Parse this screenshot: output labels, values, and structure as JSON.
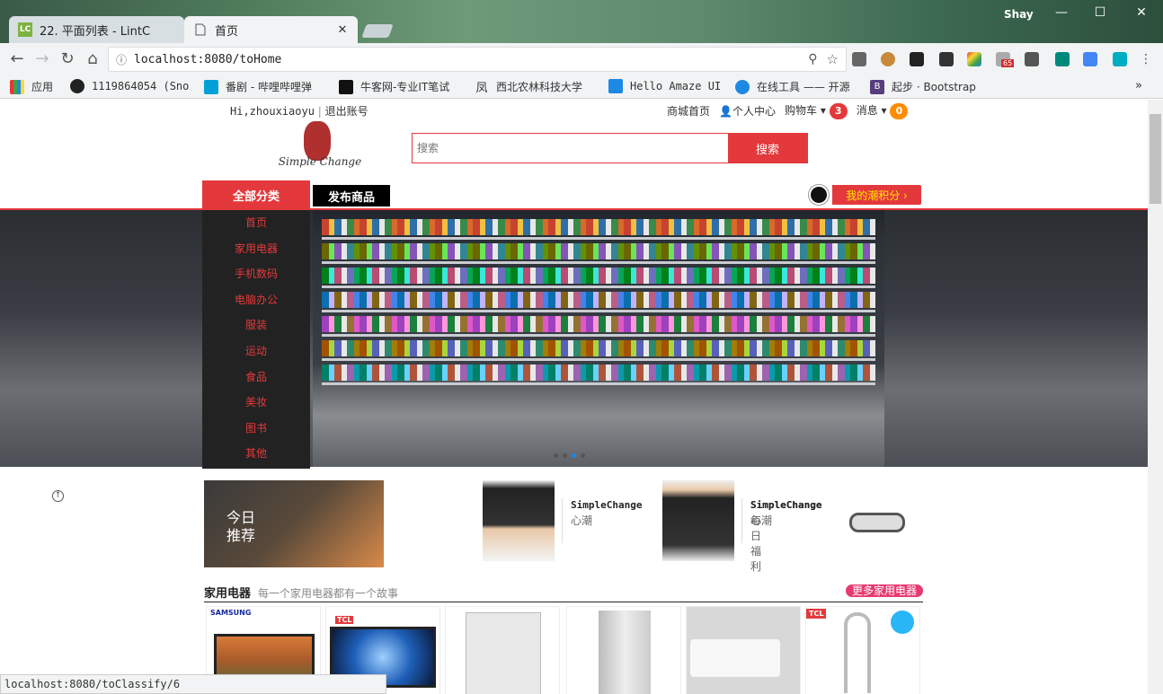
{
  "browser": {
    "tabs": [
      {
        "icon": "LC",
        "title": "22. 平面列表 - LintC",
        "active": false
      },
      {
        "icon": "page-icon",
        "title": "首页",
        "active": true
      }
    ],
    "user": "Shay",
    "url": "localhost:8080/toHome",
    "extension_badge": "65",
    "bookmarks": [
      {
        "label": "应用"
      },
      {
        "label": "1119864054 (Sno"
      },
      {
        "label": "番剧 - 哔哩哔哩弹"
      },
      {
        "label": "牛客网-专业IT笔试"
      },
      {
        "label": "西北农林科技大学"
      },
      {
        "label": "Hello Amaze UI"
      },
      {
        "label": "在线工具 —— 开源"
      },
      {
        "label": "起步 · Bootstrap"
      }
    ],
    "status_url": "localhost:8080/toClassify/6"
  },
  "site": {
    "greeting": "Hi,zhouxiaoyu",
    "logout": "退出账号",
    "nav": {
      "home": "商城首页",
      "profile": "个人中心",
      "cart": "购物车",
      "cart_count": "3",
      "messages": "消息",
      "message_count": "0"
    },
    "logo_text": "Simple Change",
    "search": {
      "placeholder": "搜索",
      "button": "搜索"
    },
    "all_categories": "全部分类",
    "publish": "发布商品",
    "points": "我的潮积分 ›",
    "categories": [
      "首页",
      "家用电器",
      "手机数码",
      "电脑办公",
      "服装",
      "运动",
      "食品",
      "美妆",
      "图书",
      "其他"
    ],
    "today": "今日推荐",
    "recommendations": [
      {
        "title": "SimpleChange",
        "subtitle": "心潮"
      },
      {
        "title": "SimpleChange",
        "subtitle": "心潮"
      },
      {
        "title": "SimpleChange",
        "subtitle": "每日福利"
      }
    ],
    "section": {
      "title": "家用电器",
      "subtitle": "每一个家用电器都有一个故事",
      "more": "更多家用电器"
    },
    "products": [
      {
        "brand": "SAMSUNG"
      },
      {
        "brand": "TCL"
      },
      {
        "brand": ""
      },
      {
        "brand": ""
      },
      {
        "brand": ""
      },
      {
        "brand": "TCL"
      }
    ]
  },
  "colors": {
    "accent": "#e4393c",
    "badge_orange": "#ff8c00"
  }
}
